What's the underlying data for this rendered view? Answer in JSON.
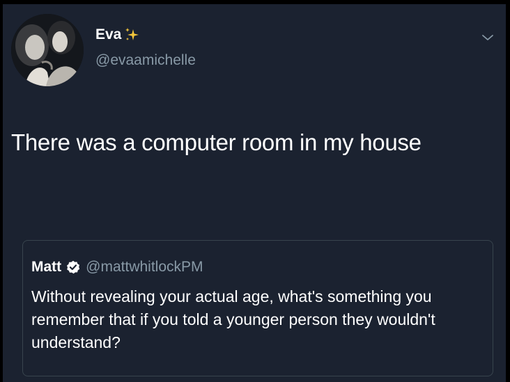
{
  "tweet": {
    "author": {
      "name": "Eva",
      "handle": "@evaamichelle",
      "name_emoji_icon": "sparkles-icon",
      "avatar_icon": "profile-photo"
    },
    "text": "There was a computer room in my house",
    "menu_icon": "chevron-down-icon"
  },
  "quoted_tweet": {
    "author": {
      "name": "Matt",
      "handle": "@mattwhitlockPM",
      "verified_icon": "verified-badge-icon"
    },
    "text": "Without revealing your actual age, what's something you remember that if you told a younger person they wouldn't understand?"
  },
  "colors": {
    "background": "#1b2230",
    "primary_text": "#ffffff",
    "secondary_text": "#8899a6",
    "border": "#38444d",
    "sparkle": "#f5c73b"
  }
}
